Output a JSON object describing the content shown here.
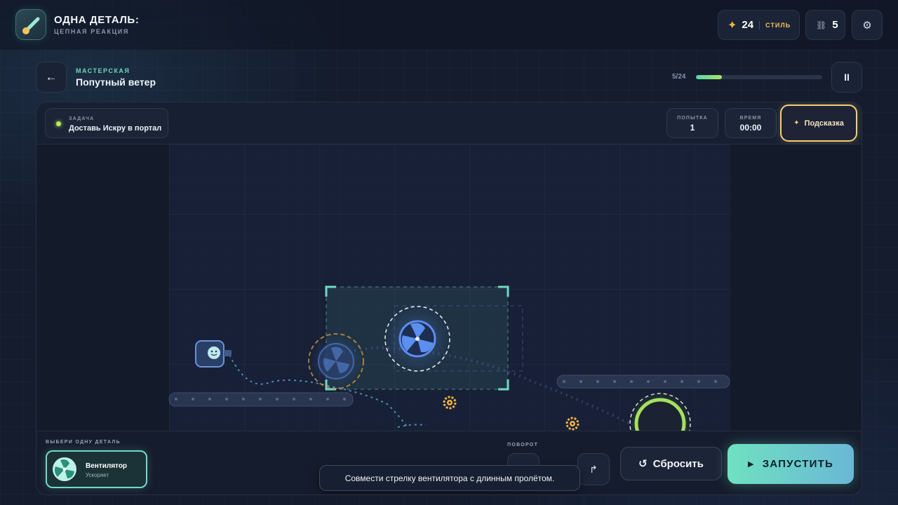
{
  "header": {
    "title": "ОДНА ДЕТАЛЬ:",
    "subtitle": "ЦЕПНАЯ РЕАКЦИЯ",
    "score_value": "24",
    "score_label": "СТИЛЬ",
    "links_value": "5",
    "icons": {
      "logo": "comet-logo",
      "score": "star-icon",
      "links": "chain-icon",
      "settings": "gear-icon"
    }
  },
  "level": {
    "kicker": "МАСТЕРСКАЯ",
    "title": "Попутный ветер",
    "progress_text": "5/24",
    "progress_fraction": 0.208
  },
  "task": {
    "label": "ЗАДАЧА",
    "text": "Доставь Искру в портал"
  },
  "stats": {
    "attempt_label": "ПОПЫТКА",
    "attempt_value": "1",
    "time_label": "ВРЕМЯ",
    "time_value": "00:00"
  },
  "hint_button": "Подсказка",
  "tray": {
    "choose_label": "ВЫБЕРИ ОДНУ ДЕТАЛЬ",
    "part_name": "Вентилятор",
    "part_desc": "Ускоряет",
    "rotation_label": "ПОВОРОТ",
    "reset_label": "Сбросить",
    "run_label": "ЗАПУСТИТЬ",
    "tooltip": "Совмести стрелку вентилятора с длинным пролётом."
  },
  "colors": {
    "accent_teal": "#72d9c2",
    "accent_gold": "#f4cf6e",
    "fan_blue": "#5b8ff0",
    "portal_green": "#a6e05a"
  }
}
